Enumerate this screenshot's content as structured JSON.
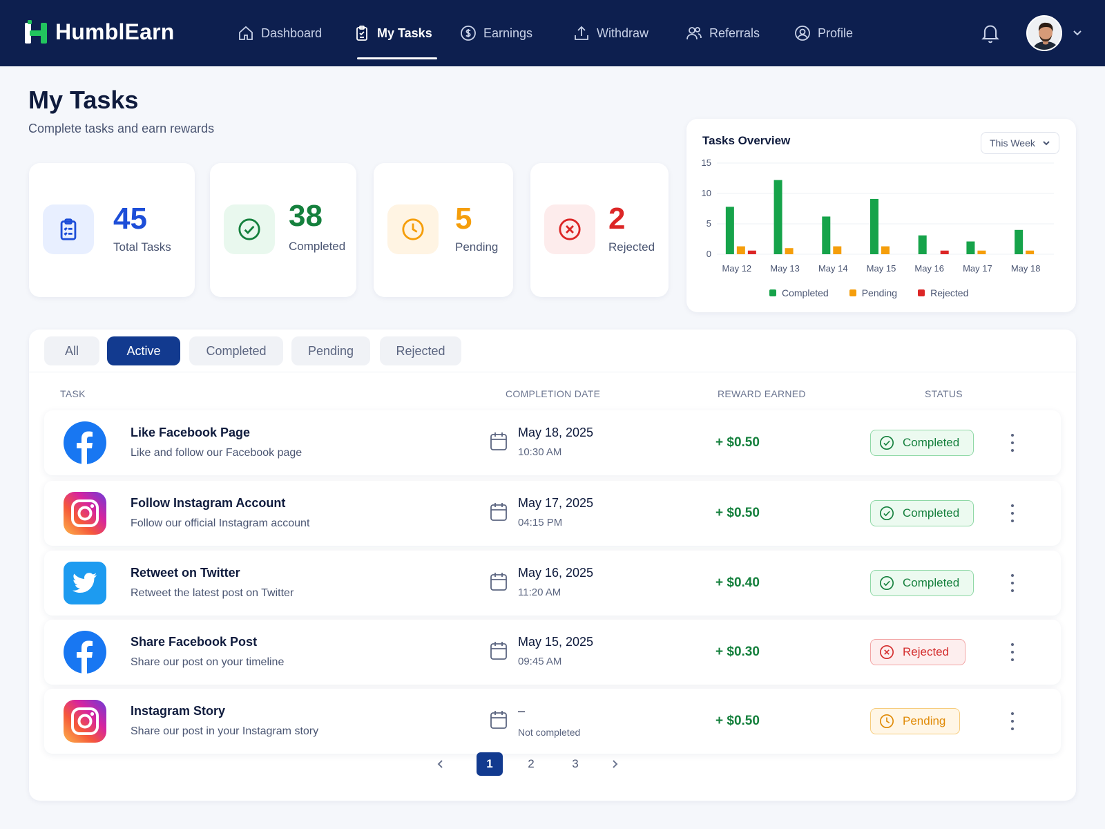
{
  "nav": {
    "brand": "HumblEarn",
    "items": [
      {
        "label": "Dashboard",
        "icon": "home-icon"
      },
      {
        "label": "My Tasks",
        "icon": "clipboard-icon",
        "active": true
      },
      {
        "label": "Earnings",
        "icon": "dollar-icon"
      },
      {
        "label": "Withdraw",
        "icon": "upload-icon"
      },
      {
        "label": "Referrals",
        "icon": "users-icon"
      },
      {
        "label": "Profile",
        "icon": "user-circle-icon"
      }
    ]
  },
  "header": {
    "title": "My Tasks",
    "subtitle": "Complete tasks and earn rewards"
  },
  "stats": {
    "total": {
      "value": "45",
      "label": "Total Tasks",
      "color": "#1d4ed8"
    },
    "completed": {
      "value": "38",
      "label": "Completed",
      "color": "#15803d"
    },
    "pending": {
      "value": "5",
      "label": "Pending",
      "color": "#f59e0b"
    },
    "rejected": {
      "value": "2",
      "label": "Rejected",
      "color": "#dc2626"
    }
  },
  "overview": {
    "title": "Tasks Overview",
    "range": "This Week"
  },
  "chart_data": {
    "type": "bar",
    "categories": [
      "May 12",
      "May 13",
      "May 14",
      "May 15",
      "May 16",
      "May 17",
      "May 18"
    ],
    "series": [
      {
        "name": "Completed",
        "color": "#16a34a",
        "values": [
          7.8,
          12.2,
          6.2,
          9.1,
          3.1,
          2.1,
          4.0
        ]
      },
      {
        "name": "Pending",
        "color": "#f59e0b",
        "values": [
          1.3,
          1.0,
          1.3,
          1.3,
          0,
          0.6,
          0.6
        ]
      },
      {
        "name": "Rejected",
        "color": "#dc2626",
        "values": [
          0.6,
          0,
          0,
          0,
          0.6,
          0,
          0
        ]
      }
    ],
    "yticks": [
      0,
      5,
      10,
      15
    ],
    "ylim": [
      0,
      15
    ],
    "grid": true,
    "legend": "bottom"
  },
  "tabs": [
    "All",
    "Active",
    "Completed",
    "Pending",
    "Rejected"
  ],
  "active_tab": "Active",
  "columns": {
    "task": "TASK",
    "date": "COMPLETION DATE",
    "reward": "REWARD EARNED",
    "status": "STATUS"
  },
  "rows": [
    {
      "platform": "facebook",
      "title": "Like Facebook Page",
      "desc": "Like and follow our Facebook page",
      "date": "May 18, 2025",
      "time": "10:30 AM",
      "reward": "+ $0.50",
      "status": "Completed"
    },
    {
      "platform": "instagram",
      "title": "Follow Instagram Account",
      "desc": "Follow our official Instagram account",
      "date": "May 17, 2025",
      "time": "04:15 PM",
      "reward": "+ $0.50",
      "status": "Completed"
    },
    {
      "platform": "twitter",
      "title": "Retweet on Twitter",
      "desc": "Retweet the latest post on Twitter",
      "date": "May 16, 2025",
      "time": "11:20 AM",
      "reward": "+ $0.40",
      "status": "Completed"
    },
    {
      "platform": "facebook",
      "title": "Share Facebook Post",
      "desc": "Share our post on your timeline",
      "date": "May 15, 2025",
      "time": "09:45 AM",
      "reward": "+ $0.30",
      "status": "Rejected"
    },
    {
      "platform": "instagram",
      "title": "Instagram Story",
      "desc": "Share our post in your Instagram story",
      "date": "–",
      "time": "Not completed",
      "reward": "+ $0.50",
      "status": "Pending"
    }
  ],
  "pagination": {
    "pages": [
      "1",
      "2",
      "3"
    ],
    "current": "1"
  }
}
